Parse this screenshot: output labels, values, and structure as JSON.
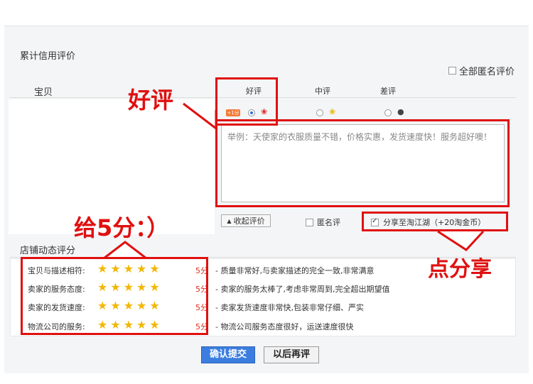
{
  "title": "累计信用评价",
  "anonymous_all_label": "全部匿名评价",
  "item_column": "宝贝",
  "rating_headers": {
    "good": "好评",
    "neutral": "中评",
    "bad": "差评"
  },
  "bonus_badge": "+1分",
  "review_placeholder": "举例：天使家的衣服质量不错，价格实惠，发货速度快！服务超好噢！",
  "collapse_label": "收起评价",
  "anonymous_label": "匿名评",
  "share_label": "分享至淘江湖（+20淘金币）",
  "shop_section_title": "店铺动态评分",
  "shop_ratings": [
    {
      "label": "宝贝与描述相符:",
      "stars": 5,
      "score": "5分",
      "desc": "质量非常好,与卖家描述的完全一致,非常满意"
    },
    {
      "label": "卖家的服务态度:",
      "stars": 5,
      "score": "5分",
      "desc": "卖家的服务太棒了,考虑非常周到,完全超出期望值"
    },
    {
      "label": "卖家的发货速度:",
      "stars": 5,
      "score": "5分",
      "desc": "卖家发货速度非常快,包装非常仔细、严实"
    },
    {
      "label": "物流公司的服务:",
      "stars": 5,
      "score": "5分",
      "desc": "物流公司服务态度很好，运送速度很快"
    }
  ],
  "confirm_label": "确认提交",
  "later_label": "以后再评",
  "annotations": {
    "good_review": "好评",
    "give_five": "给5分：）",
    "click_share": "点分享"
  },
  "colors": {
    "annotation_red": "#e01010",
    "primary_blue": "#3b7ee0",
    "star_gold": "#f2b705",
    "score_red": "#e0301e"
  }
}
